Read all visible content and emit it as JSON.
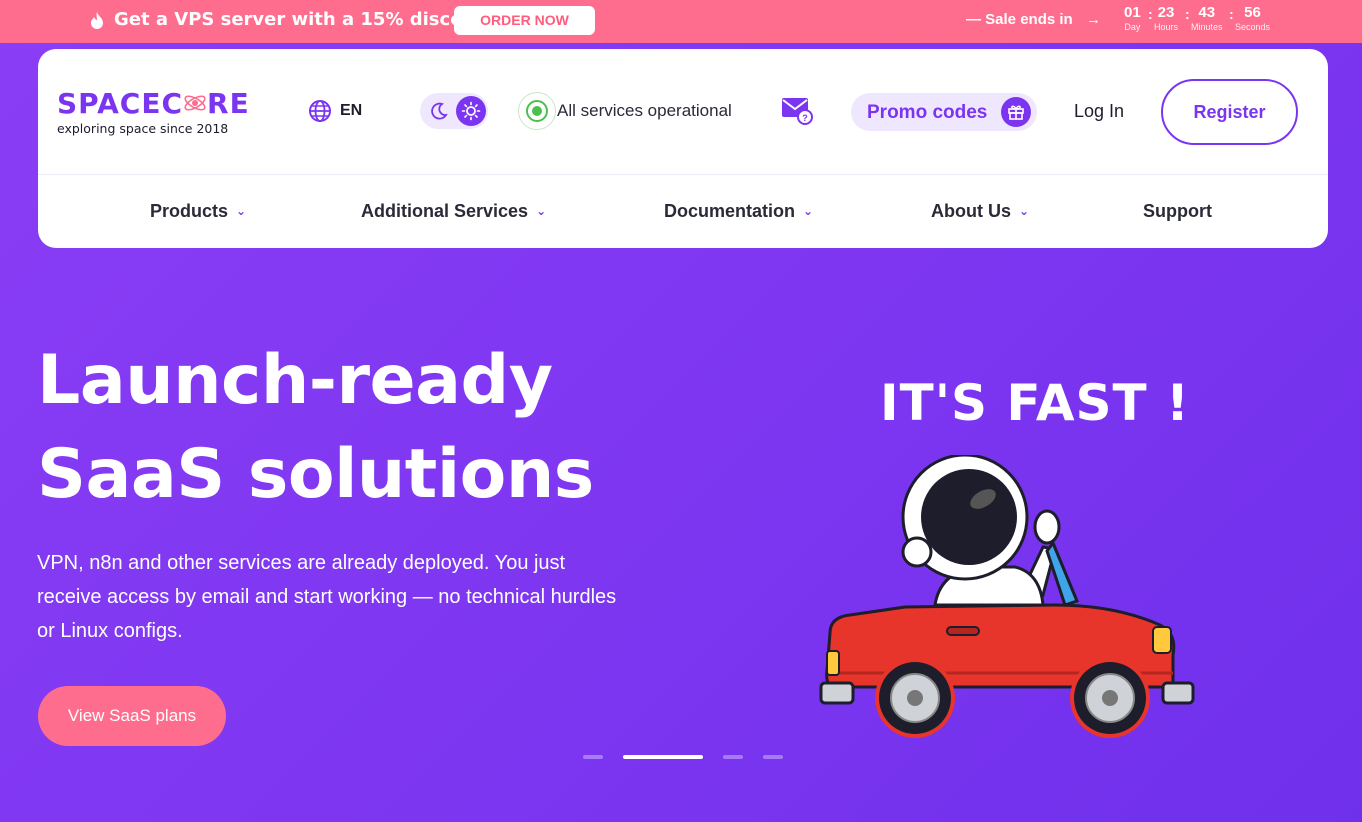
{
  "promo_banner": {
    "text": "Get a VPS server with a 15% discount",
    "order_button": "ORDER NOW",
    "sale_label": "— Sale ends in",
    "arrow": "→",
    "timer": [
      {
        "value": "01",
        "unit": "Day"
      },
      {
        "value": "23",
        "unit": "Hours"
      },
      {
        "value": "43",
        "unit": "Minutes"
      },
      {
        "value": "56",
        "unit": "Seconds"
      }
    ],
    "separator": ":"
  },
  "header": {
    "logo": "SPACECORE",
    "logo_left": "SPACEC",
    "logo_right": "RE",
    "tagline": "exploring space since 2018",
    "language": "EN",
    "status": "All services operational",
    "promo_codes": "Promo codes",
    "login": "Log In",
    "register": "Register"
  },
  "nav": {
    "items": [
      {
        "label": "Products",
        "has_dropdown": true
      },
      {
        "label": "Additional Services",
        "has_dropdown": true
      },
      {
        "label": "Documentation",
        "has_dropdown": true
      },
      {
        "label": "About Us",
        "has_dropdown": true
      },
      {
        "label": "Support",
        "has_dropdown": false
      }
    ],
    "chevron": "⌄"
  },
  "hero": {
    "title_line1": "Launch-ready",
    "title_line2": "SaaS solutions",
    "subtitle_line1": "VPN, n8n and other services are already deployed. You just",
    "subtitle_line2": "receive access by email and start working — no technical hurdles",
    "subtitle_line3": "or Linux configs.",
    "button": "View SaaS plans",
    "slide_caption": "IT'S FAST !",
    "slider_active_index": 1,
    "slider_count": 4
  },
  "colors": {
    "brand_purple": "#7b35f0",
    "promo_pink": "#ff6d8e",
    "status_green": "#4cc04c"
  },
  "icons": [
    "fire-icon",
    "globe-icon",
    "moon-icon",
    "sun-icon",
    "mail-question-icon",
    "gift-icon"
  ]
}
